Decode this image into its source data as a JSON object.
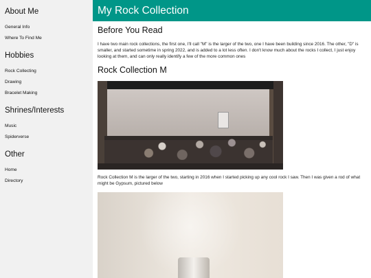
{
  "sidebar": {
    "sections": [
      {
        "title": "About Me",
        "links": [
          "General Info",
          "Where To Find Me"
        ]
      },
      {
        "title": "Hobbies",
        "links": [
          "Rock Collecting",
          "Drawing",
          "Bracelet Making"
        ]
      },
      {
        "title": "Shrines/Interests",
        "links": [
          "Music",
          "Spiderverse"
        ]
      },
      {
        "title": "Other",
        "links": [
          "Home",
          "Directory"
        ]
      }
    ]
  },
  "header": {
    "title": "My Rock Collection"
  },
  "main": {
    "before_heading": "Before You Read",
    "before_text": "I have two main rock collections, the first one, I'll call \"M\" is the larger of the two, one I have been building since 2016. The other, \"D\" is smaller, and started sometime in spring 2022, and is added to a lot less often. I don't know much about the rocks I collect, I just enjoy looking at them, and can only really identify a few of the more common ones",
    "collection_heading": "Rock Collection M",
    "collection_text": "Rock Collection M is the larger of the two, starting in 2016 when I started picking up any cool rock I saw. Then I was given a rod of what might be Gypsum, pictured below"
  },
  "colors": {
    "header_bg": "#009688",
    "sidebar_bg": "#f1f1f1"
  }
}
